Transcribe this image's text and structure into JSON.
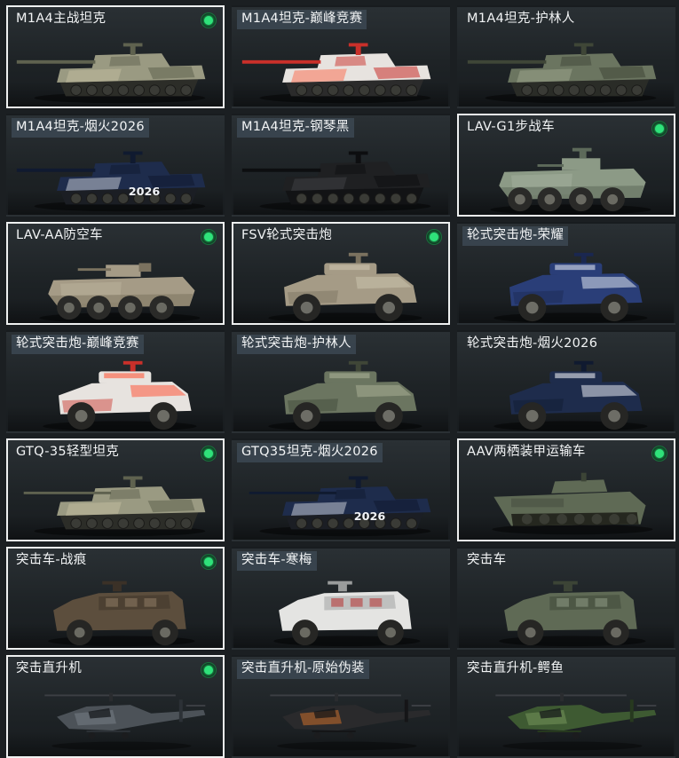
{
  "cards": [
    {
      "label": "M1A4主战坦克",
      "owned": true,
      "vehicle": "tank",
      "skin": "desert-camo"
    },
    {
      "label": "M1A4坦克-巅峰竞赛",
      "owned": false,
      "vehicle": "tank",
      "skin": "red-white"
    },
    {
      "label": "M1A4坦克-护林人",
      "owned": false,
      "vehicle": "tank",
      "skin": "forest-camo"
    },
    {
      "label": "M1A4坦克-烟火2026",
      "owned": false,
      "vehicle": "tank",
      "skin": "navy-fireworks",
      "decal": "2026"
    },
    {
      "label": "M1A4坦克-钢琴黑",
      "owned": false,
      "vehicle": "tank",
      "skin": "piano-black"
    },
    {
      "label": "LAV-G1步战车",
      "owned": true,
      "vehicle": "ifv-8wheel",
      "skin": "green-grey"
    },
    {
      "label": "LAV-AA防空车",
      "owned": true,
      "vehicle": "aa-8wheel",
      "skin": "tan"
    },
    {
      "label": "FSV轮式突击炮",
      "owned": true,
      "vehicle": "assault-gun-4wheel",
      "skin": "tan"
    },
    {
      "label": "轮式突击炮-荣耀",
      "owned": false,
      "vehicle": "assault-gun-4wheel",
      "skin": "blue-white"
    },
    {
      "label": "轮式突击炮-巅峰竞赛",
      "owned": false,
      "vehicle": "assault-gun-4wheel",
      "skin": "red-white"
    },
    {
      "label": "轮式突击炮-护林人",
      "owned": false,
      "vehicle": "assault-gun-4wheel",
      "skin": "forest-camo"
    },
    {
      "label": "轮式突击炮-烟火2026",
      "owned": false,
      "vehicle": "assault-gun-4wheel",
      "skin": "navy-fireworks"
    },
    {
      "label": "GTQ-35轻型坦克",
      "owned": true,
      "vehicle": "light-tank",
      "skin": "desert-camo"
    },
    {
      "label": "GTQ35坦克-烟火2026",
      "owned": false,
      "vehicle": "light-tank",
      "skin": "navy-fireworks",
      "decal": "2026"
    },
    {
      "label": "AAV两栖装甲运输车",
      "owned": true,
      "vehicle": "amphibious-apc",
      "skin": "olive"
    },
    {
      "label": "突击车-战痕",
      "owned": true,
      "vehicle": "assault-vehicle",
      "skin": "brown-battle"
    },
    {
      "label": "突击车-寒梅",
      "owned": false,
      "vehicle": "assault-vehicle",
      "skin": "white-plum"
    },
    {
      "label": "突击车",
      "owned": false,
      "vehicle": "assault-vehicle",
      "skin": "olive"
    },
    {
      "label": "突击直升机",
      "owned": true,
      "vehicle": "helicopter",
      "skin": "dark-grey"
    },
    {
      "label": "突击直升机-原始伪装",
      "owned": false,
      "vehicle": "helicopter",
      "skin": "black-orange"
    },
    {
      "label": "突击直升机-鳄鱼",
      "owned": false,
      "vehicle": "helicopter",
      "skin": "green-camo"
    }
  ],
  "colors": {
    "owned_badge": "#2fe27a",
    "owned_border": "#eef0f0",
    "background": "#1b1f22"
  }
}
